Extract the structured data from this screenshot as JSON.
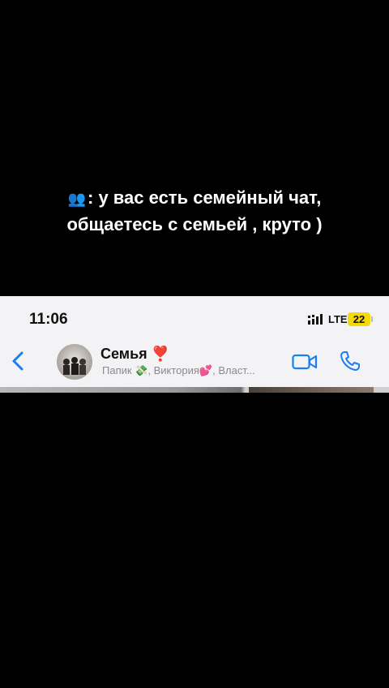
{
  "caption": {
    "emoji": "👥",
    "line1": ": у вас есть семейный чат,",
    "line2": "общаетесь с семьей , круто )"
  },
  "status_bar": {
    "time": "11:06",
    "network": "LTE",
    "battery_level": "22"
  },
  "chat_header": {
    "title": "Семья ❣️",
    "subtitle": "Папик 💸, Виктория💕, Власт..."
  },
  "colors": {
    "accent": "#1a7ef2",
    "battery": "#f5d90a"
  }
}
